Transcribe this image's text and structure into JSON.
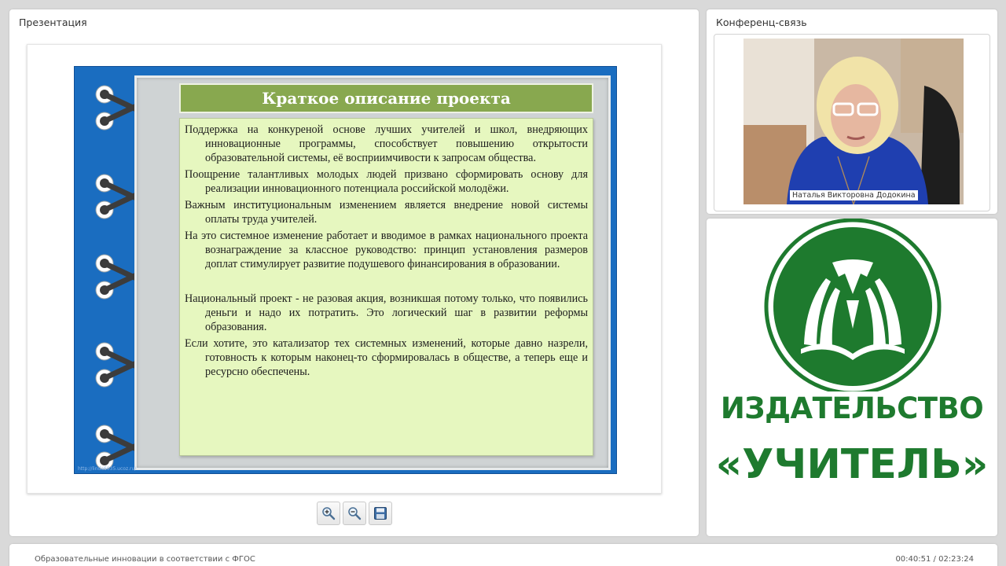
{
  "presentation": {
    "title": "Презентация",
    "slide": {
      "header": "Краткое описание проекта",
      "paragraphs": [
        "Поддержка на конкуреной основе лучших учителей и школ, внедряющих инновационные программы, способствует повышению открытости образовательной системы, её восприимчивости к запросам общества.",
        "Поощрение талантливых молодых людей призвано сформировать основу для реализации инновационного потенциала российской молодёжи.",
        "Важным институциональным изменением является внедрение новой системы оплаты труда учителей.",
        "На это системное изменение работает и вводимое в рамках национального проекта вознаграждение за классное руководство: принцип установления размеров доплат стимулирует развитие подушевого финансирования в образовании.",
        "Национальный проект - не разовая акция, возникшая потому только, что появились деньги и надо их потратить. Это логический шаг в развитии реформы образования.",
        "Если хотите, это катализатор тех системных изменений, которые давно назрели, готовность к которым наконец-то сформировалась в обществе, а теперь еще и ресурсно обеспечены."
      ],
      "watermark": "http://linda6035.ucoz.ru/"
    },
    "toolbar": {
      "zoom_in_icon": "zoom-in-icon",
      "zoom_out_icon": "zoom-out-icon",
      "save_icon": "floppy-disk-icon"
    }
  },
  "conference": {
    "title": "Конференц-связь",
    "speaker_name": "Наталья Викторовна Додокина"
  },
  "logo": {
    "line1": "ИЗДАТЕЛЬСТВО",
    "line2": "«УЧИТЕЛЬ»",
    "color": "#1e7a2e"
  },
  "footer": {
    "course_title": "Образовательные инновации в соответствии с ФГОС",
    "time": "00:40:51 / 02:23:24"
  }
}
